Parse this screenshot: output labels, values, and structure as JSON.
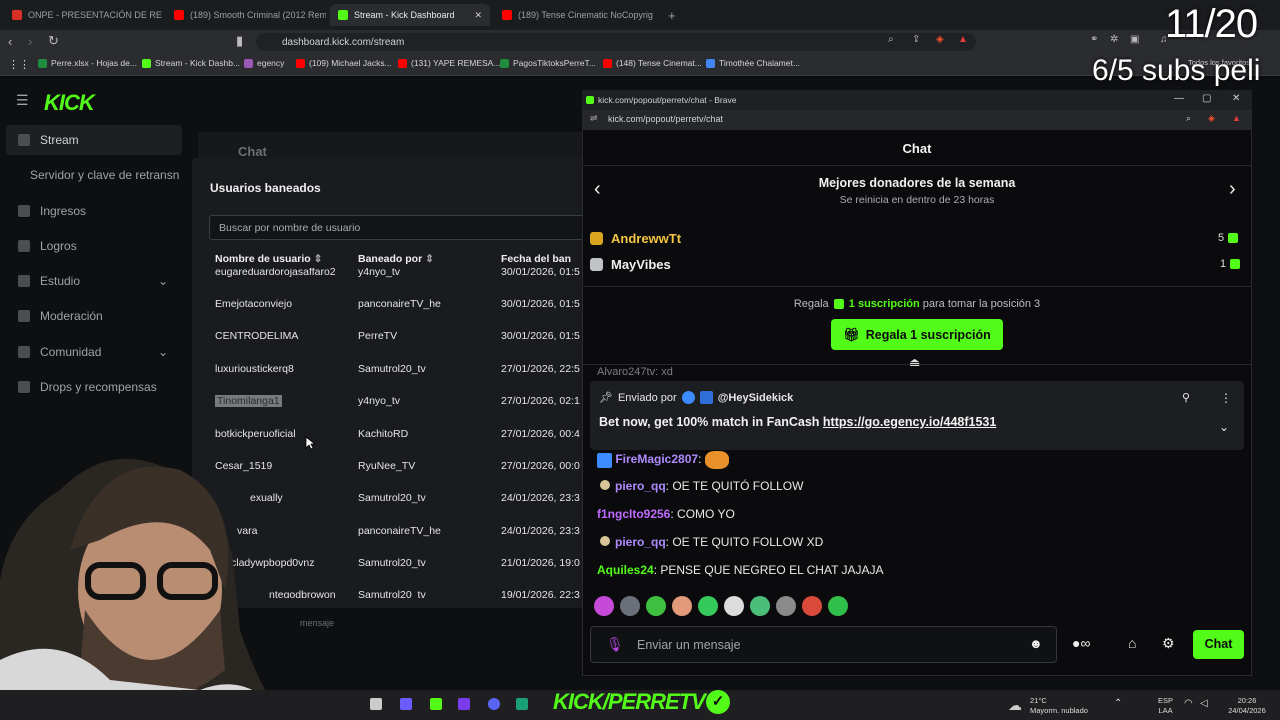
{
  "browser": {
    "tabs": [
      {
        "label": "ONPE - PRESENTACIÓN DE RESULTA",
        "active": false,
        "color": "#d93025"
      },
      {
        "label": "(189) Smooth Criminal (2012 Remast",
        "active": false,
        "color": "#ff0000"
      },
      {
        "label": "Stream - Kick Dashboard",
        "active": true,
        "color": "#53fc18"
      },
      {
        "label": "(189) Tense Cinematic NoCopyrig",
        "active": false,
        "color": "#ff0000"
      }
    ],
    "url": "dashboard.kick.com/stream",
    "bookmarks": [
      {
        "label": "Perre.xlsx - Hojas de...",
        "color": "#1e8e3e"
      },
      {
        "label": "Stream - Kick Dashb...",
        "color": "#53fc18"
      },
      {
        "label": "egency",
        "color": "#9b59b6"
      },
      {
        "label": "(109) Michael Jacks...",
        "color": "#ff0000"
      },
      {
        "label": "(131) YAPE REMESA...",
        "color": "#ff0000"
      },
      {
        "label": "PagosTiktoksPerreT...",
        "color": "#1e8e3e"
      },
      {
        "label": "(148) Tense Cinemat...",
        "color": "#ff0000"
      },
      {
        "label": "Timothée Chalamet...",
        "color": "#4285f4"
      }
    ],
    "all_favorites": "Todos los favoritos"
  },
  "dashboard": {
    "logo": "KICK",
    "sidebar": [
      {
        "label": "Stream",
        "icon": "stream-icon"
      },
      {
        "label": "Servidor y clave de retransn",
        "icon": ""
      },
      {
        "label": "Ingresos",
        "icon": "dollar-icon"
      },
      {
        "label": "Logros",
        "icon": "trophy-icon"
      },
      {
        "label": "Estudio",
        "icon": "studio-icon"
      },
      {
        "label": "Moderación",
        "icon": "wrench-icon"
      },
      {
        "label": "Comunidad",
        "icon": "community-icon"
      },
      {
        "label": "Drops y recompensas",
        "icon": "gift-icon"
      }
    ],
    "chat_label": "Chat",
    "message_hint": "mensaje"
  },
  "banned_modal": {
    "title": "Usuarios baneados",
    "search_placeholder": "Buscar por nombre de usuario",
    "columns": [
      "Nombre de usuario",
      "Baneado por",
      "Fecha del ban"
    ],
    "rows": [
      [
        "eugareduardorojasaffaro2",
        "y4nyo_tv",
        "30/01/2026, 01:5"
      ],
      [
        "Emejotaconviejo",
        "panconaireTV_he",
        "30/01/2026, 01:5"
      ],
      [
        "CENTRODELIMA",
        "PerreTV",
        "30/01/2026, 01:5"
      ],
      [
        "luxurioustickerq8",
        "Samutrol20_tv",
        "27/01/2026, 22:5"
      ],
      [
        "Tinomilanga1",
        "y4nyo_tv",
        "27/01/2026, 02:1"
      ],
      [
        "botkickperuoficial",
        "KachitoRD",
        "27/01/2026, 00:4"
      ],
      [
        "Cesar_1519",
        "RyuNee_TV",
        "27/01/2026, 00:0"
      ],
      [
        "exually",
        "Samutrol20_tv",
        "24/01/2026, 23:3"
      ],
      [
        "vara",
        "panconaireTV_he",
        "24/01/2026, 23:3"
      ],
      [
        "cladywpbopd0vnz",
        "Samutrol20_tv",
        "21/01/2026, 19:0"
      ],
      [
        "ntegodbrowon",
        "Samutrol20_tv",
        "19/01/2026, 22:3"
      ]
    ]
  },
  "popout": {
    "window_title": "kick.com/popout/perretv/chat - Brave",
    "url": "kick.com/popout/perretv/chat",
    "header": "Chat",
    "leaderboard_title": "Mejores donadores de la semana",
    "leaderboard_sub": "Se reinicia en dentro de 23 horas",
    "donors": [
      {
        "name": "AndrewwTt",
        "count": "5",
        "color": "#f5c542"
      },
      {
        "name": "MayVibes",
        "count": "1",
        "color": "#f0f0f0"
      }
    ],
    "gift_prefix": "Regala",
    "gift_link": "1 suscripción",
    "gift_suffix": "para tomar la posición 3",
    "gift_button": "Regala 1 suscripción",
    "pinned_prefix": "Enviado por",
    "pinned_user": "@HeySidekick",
    "pinned_text": "Bet now, get 100% match in FanCash",
    "pinned_link": "https://go.egency.io/448f1531",
    "partial_message": "Alvaro247tv: xd",
    "messages": [
      {
        "user": "FireMagic2807",
        "text": "",
        "color": "#b08bff",
        "badge": true,
        "emoji": true
      },
      {
        "user": "piero_qq",
        "text": "OE TE QUITÓ FOLLOW",
        "color": "#b08bff",
        "badge": true
      },
      {
        "user": "f1ngcIto9256",
        "text": "COMO YO",
        "color": "#c06bff",
        "badge": false
      },
      {
        "user": "piero_qq",
        "text": "OE TE QUITO FOLLOW XD",
        "color": "#b08bff",
        "badge": true
      },
      {
        "user": "Aquiles24",
        "text": "PENSE QUE NEGREO EL CHAT JAJAJA",
        "color": "#53fc18",
        "badge": false
      }
    ],
    "input_placeholder": "Enviar un mensaje",
    "chat_button": "Chat"
  },
  "overlay": {
    "count": "11/20",
    "subs": "6/5 subs peli",
    "brand": "KICK/PERRETV"
  },
  "taskbar": {
    "weather_temp": "21°C",
    "weather_desc": "Mayorm. nublado",
    "lang1": "ESP",
    "lang2": "LAA",
    "time": "20:26",
    "date": "24/04/2026"
  }
}
